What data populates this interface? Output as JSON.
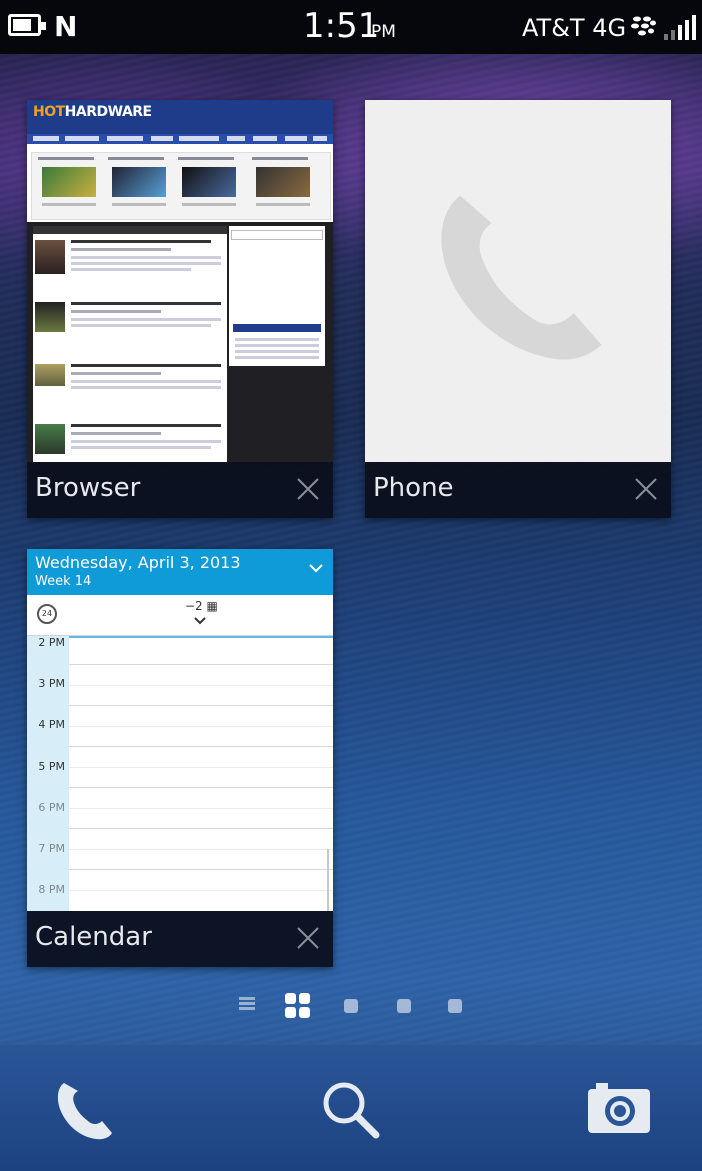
{
  "status_bar": {
    "time": "1:51",
    "ampm": "PM",
    "carrier": "AT&T 4G",
    "nfc_glyph": "N",
    "icons": [
      "battery-icon",
      "nfc-icon",
      "blackberry-icon",
      "signal-icon"
    ]
  },
  "cards": {
    "browser": {
      "title": "Browser",
      "logo_main": "HOT",
      "logo_sub": "HARDWARE"
    },
    "phone": {
      "title": "Phone"
    },
    "calendar": {
      "title": "Calendar",
      "date": "Wednesday, April 3, 2013",
      "week": "Week 14",
      "timer_label": "24",
      "count_label": "−2",
      "hours": [
        "2 PM",
        "3 PM",
        "4 PM",
        "5 PM",
        "6 PM",
        "7 PM",
        "8 PM"
      ]
    }
  },
  "colors": {
    "accent": "#0f9ad8",
    "card_bar": "#0a0e1a"
  },
  "dock": {
    "icons": [
      "phone-icon",
      "search-icon",
      "camera-icon"
    ]
  }
}
